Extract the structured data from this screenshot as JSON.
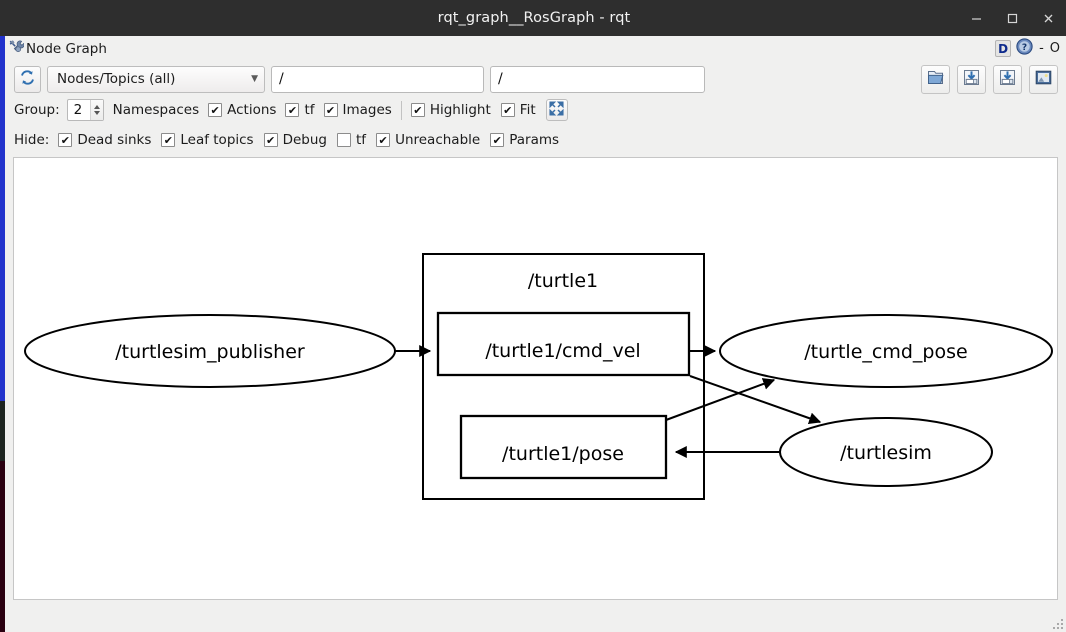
{
  "window": {
    "title": "rqt_graph__RosGraph - rqt",
    "controls": {
      "minimize": "—",
      "maximize": "□",
      "close": "✕"
    }
  },
  "dock": {
    "title": "Node Graph",
    "icon": "tools-icon",
    "float_label": "D",
    "help_label": "?",
    "minimize_label": "-",
    "close_label": "O"
  },
  "toolbar": {
    "refresh_icon": "refresh-icon",
    "filter_combo": {
      "value": "Nodes/Topics (all)",
      "caret": "▼"
    },
    "topic_filter": {
      "value": "/",
      "placeholder": "/"
    },
    "node_filter": {
      "value": "/",
      "placeholder": "/"
    },
    "actions": [
      {
        "name": "load-dot-button",
        "icon": "folder-open-icon"
      },
      {
        "name": "save-dot-button",
        "icon": "save-dot-icon"
      },
      {
        "name": "save-as-svg-button",
        "icon": "save-svg-icon"
      },
      {
        "name": "save-as-image-button",
        "icon": "save-image-icon"
      }
    ]
  },
  "group_row": {
    "label": "Group:",
    "spin_value": "2",
    "checks": [
      {
        "label": "Namespaces",
        "checked": true,
        "name": "checkbox-namespaces"
      },
      {
        "label": "Actions",
        "checked": true,
        "name": "checkbox-actions"
      },
      {
        "label": "tf",
        "checked": true,
        "name": "checkbox-tf"
      },
      {
        "label": "Images",
        "checked": true,
        "name": "checkbox-images"
      }
    ],
    "checks2": [
      {
        "label": "Highlight",
        "checked": true,
        "name": "checkbox-highlight"
      },
      {
        "label": "Fit",
        "checked": true,
        "name": "checkbox-fit"
      }
    ],
    "fit_button_icon": "fit-in-view-icon"
  },
  "hide_row": {
    "label": "Hide:",
    "checks": [
      {
        "label": "Dead sinks",
        "checked": true,
        "name": "checkbox-hide-dead-sinks"
      },
      {
        "label": "Leaf topics",
        "checked": true,
        "name": "checkbox-hide-leaf-topics"
      },
      {
        "label": "Debug",
        "checked": true,
        "name": "checkbox-hide-debug"
      },
      {
        "label": "tf",
        "checked": false,
        "name": "checkbox-hide-tf"
      },
      {
        "label": "Unreachable",
        "checked": true,
        "name": "checkbox-hide-unreachable"
      },
      {
        "label": "Params",
        "checked": true,
        "name": "checkbox-hide-params"
      }
    ]
  },
  "graph": {
    "cluster": {
      "label": "/turtle1"
    },
    "nodes": [
      {
        "id": "turtlesim_publisher",
        "label": "/turtlesim_publisher",
        "shape": "ellipse"
      },
      {
        "id": "turtle_cmd_pose",
        "label": "/turtle_cmd_pose",
        "shape": "ellipse"
      },
      {
        "id": "turtlesim",
        "label": "/turtlesim",
        "shape": "ellipse"
      }
    ],
    "topics": [
      {
        "id": "cmd_vel",
        "label": "/turtle1/cmd_vel",
        "shape": "box"
      },
      {
        "id": "pose",
        "label": "/turtle1/pose",
        "shape": "box"
      }
    ],
    "edges": [
      {
        "from": "turtlesim_publisher",
        "to": "cmd_vel"
      },
      {
        "from": "cmd_vel",
        "to": "turtle_cmd_pose"
      },
      {
        "from": "cmd_vel",
        "to": "turtlesim"
      },
      {
        "from": "pose",
        "to": "turtle_cmd_pose"
      },
      {
        "from": "turtlesim",
        "to": "pose"
      }
    ]
  },
  "colors": {
    "titlebar_bg": "#2e2e2e",
    "window_bg": "#f0f0ef",
    "canvas_bg": "#ffffff",
    "accent_blue": "#2233cc",
    "graph_stroke": "#000000"
  }
}
